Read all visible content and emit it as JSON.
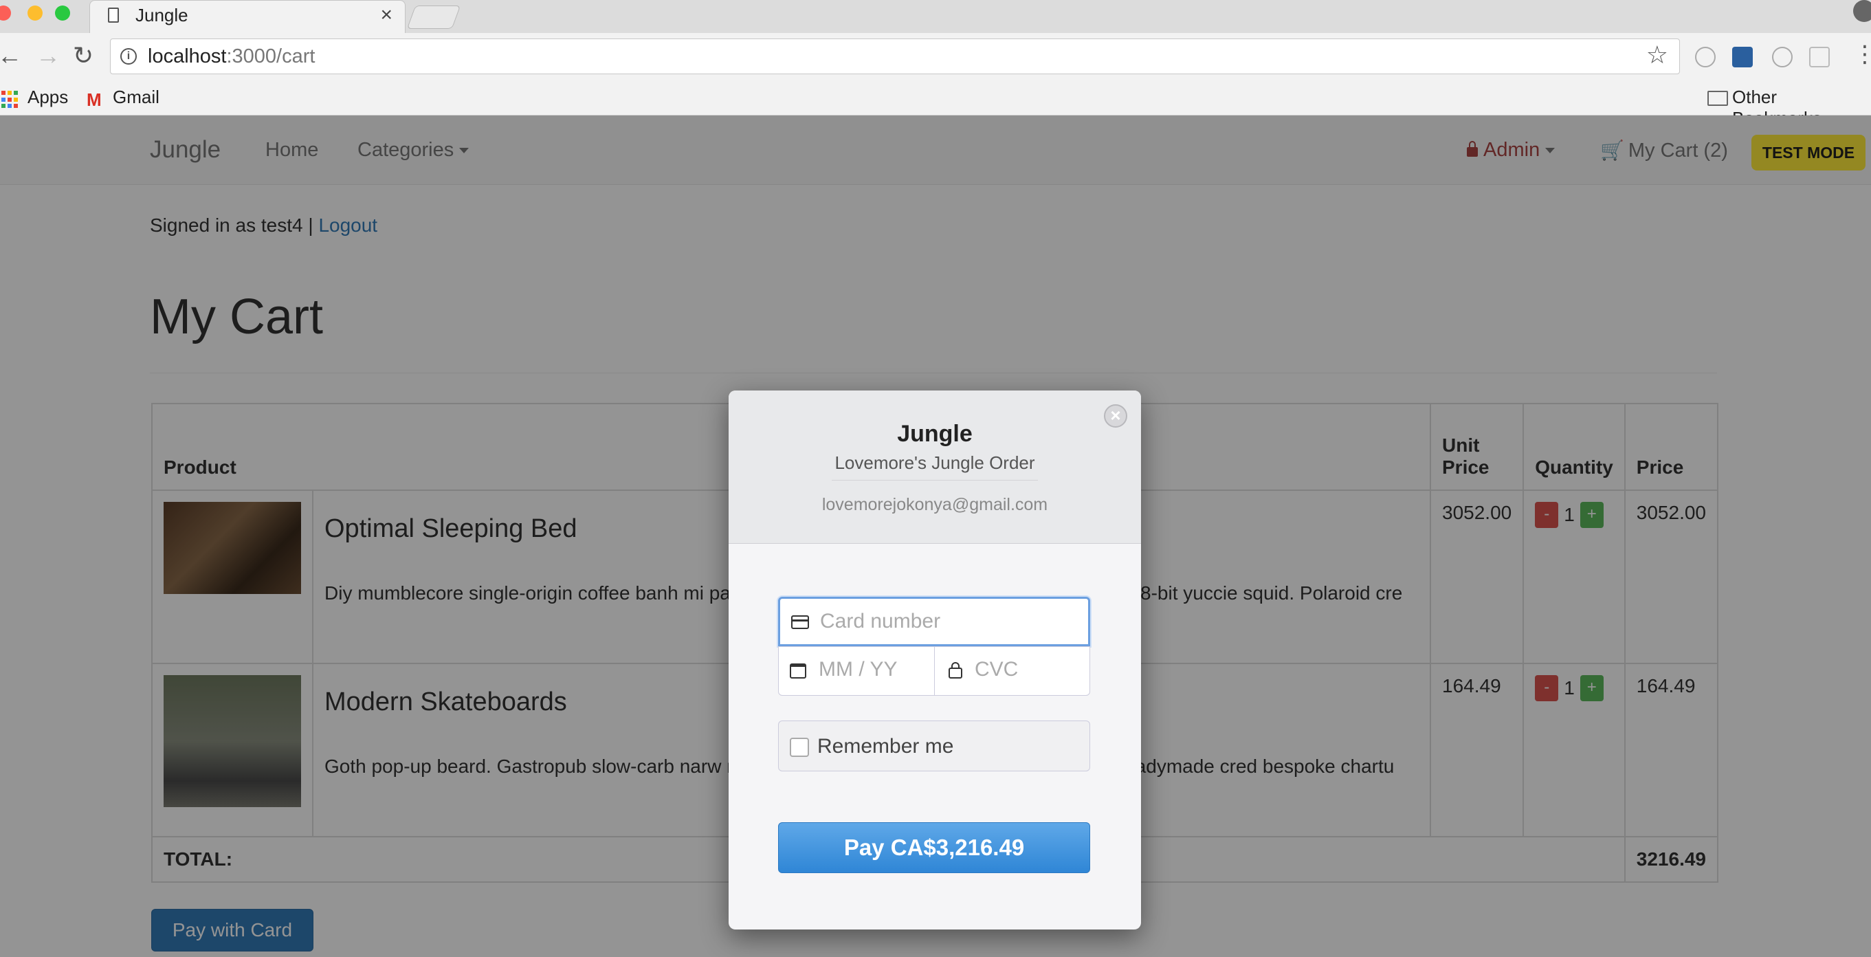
{
  "browser": {
    "tab_title": "Jungle",
    "tab_close": "×",
    "url_host": "localhost",
    "url_rest": ":3000/cart",
    "bookmarks": [
      "Apps",
      "Gmail"
    ],
    "other_bookmarks": "Other Bookmarks"
  },
  "navbar": {
    "brand": "Jungle",
    "home": "Home",
    "categories": "Categories",
    "admin": "Admin",
    "cart": "My Cart (2)",
    "test_mode": "TEST MODE"
  },
  "session": {
    "signed_in_text": "Signed in as test4 |",
    "logout": "Logout"
  },
  "page": {
    "title": "My Cart",
    "pay_button": "Pay with Card"
  },
  "table": {
    "headers": {
      "product": "Product",
      "unit_price": "Unit Price",
      "quantity": "Quantity",
      "price": "Price"
    },
    "rows": [
      {
        "name": "Optimal Sleeping Bed",
        "description": "Diy mumblecore single-origin coffee banh mi pa                                                                           e paleo bicycle rights bespoke. Artisan cleanse 8-bit yuccie squid. Polaroid cre",
        "unit_price": "3052.00",
        "quantity": "1",
        "price": "3052.00"
      },
      {
        "name": "Modern Skateboards",
        "description": "Goth pop-up beard. Gastropub slow-carb narw                                                                           netic intelligentsia cliche. Post-ironic pitchfork readymade cred bespoke chartu",
        "unit_price": "164.49",
        "quantity": "1",
        "price": "164.49"
      }
    ],
    "minus": "-",
    "plus": "+",
    "total_label": "TOTAL:",
    "total_value": "3216.49"
  },
  "checkout": {
    "title": "Jungle",
    "subtitle": "Lovemore's Jungle Order",
    "email": "lovemorejokonya@gmail.com",
    "card_placeholder": "Card number",
    "expiry_placeholder": "MM / YY",
    "cvc_placeholder": "CVC",
    "remember": "Remember me",
    "pay": "Pay CA$3,216.49",
    "close": "×"
  },
  "colors": {
    "link": "#337ab7",
    "test_mode_bg": "#ffeb3b",
    "admin": "#a94442",
    "pay_blue": "#2f86d6"
  }
}
